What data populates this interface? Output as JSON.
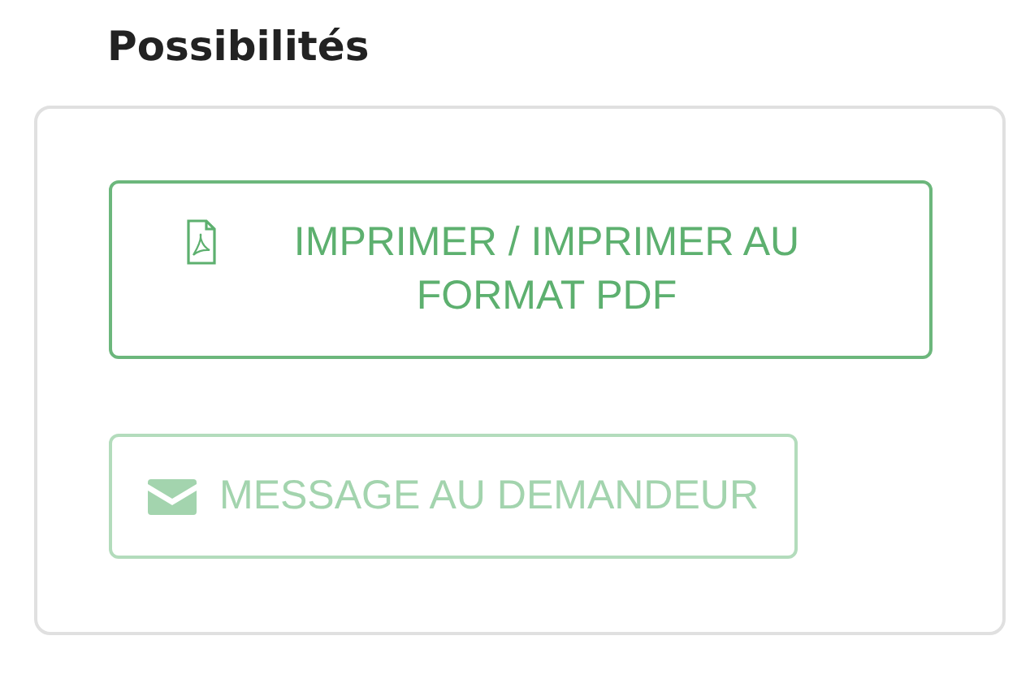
{
  "section": {
    "title": "Possibilités"
  },
  "buttons": [
    {
      "kind": "pdf",
      "label": "IMPRIMER / IMPRIMER AU FORMAT PDF",
      "disabled": false
    },
    {
      "kind": "mail",
      "label": "MESSAGE AU DEMANDEUR",
      "disabled": true
    }
  ]
}
